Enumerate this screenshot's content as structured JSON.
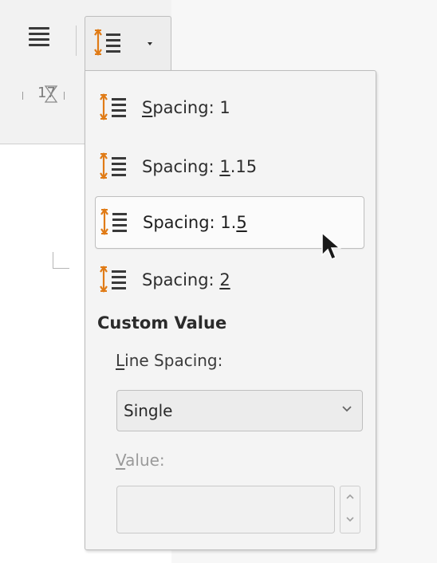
{
  "toolbar": {
    "paragraph_menu_icon": "hamburger-lines-icon",
    "spacing_button_icon": "line-spacing-icon",
    "dropdown_caret_icon": "caret-down-icon"
  },
  "ruler": {
    "number": "17"
  },
  "menu": {
    "items": [
      {
        "prefix": "",
        "mnemonic": "S",
        "suffix": "pacing: 1",
        "hovered": false
      },
      {
        "prefix": "Spacing: ",
        "mnemonic": "1",
        "suffix": ".15",
        "hovered": false
      },
      {
        "prefix": "Spacing: 1.",
        "mnemonic": "5",
        "suffix": "",
        "hovered": true
      },
      {
        "prefix": "Spacing: ",
        "mnemonic": "2",
        "suffix": "",
        "hovered": false
      }
    ],
    "custom": {
      "title": "Custom Value",
      "line_spacing_mnemonic": "L",
      "line_spacing_rest": "ine Spacing:",
      "line_spacing_value": "Single",
      "value_mnemonic": "V",
      "value_rest": "alue:",
      "value_text": ""
    }
  },
  "colors": {
    "accent_icon": "#e07b16",
    "panel_bg": "#f4f4f4",
    "hover_bg": "#fbfbfb"
  }
}
